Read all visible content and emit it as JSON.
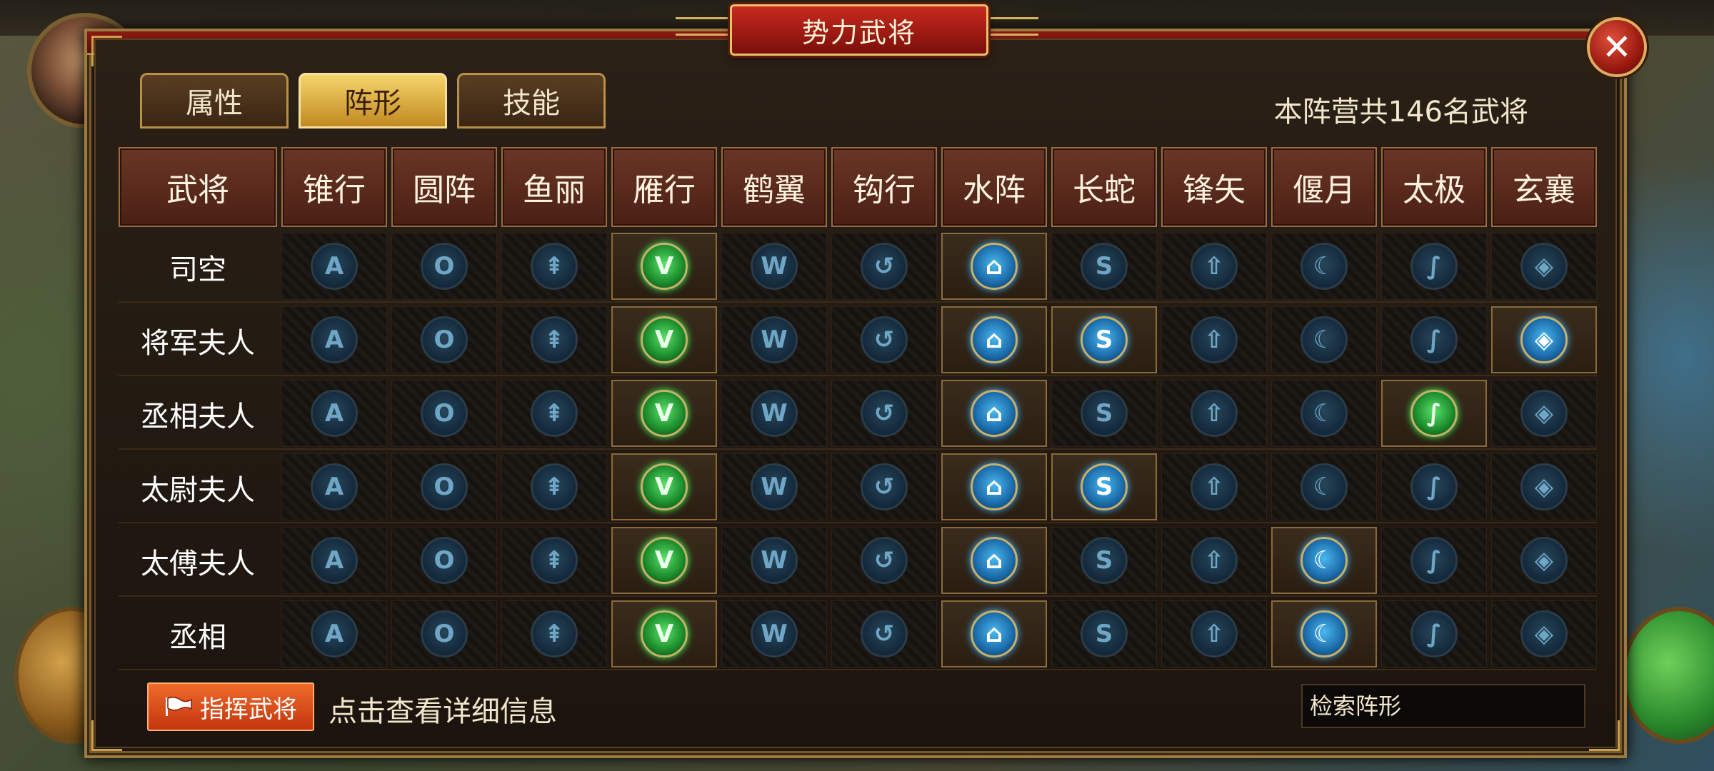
{
  "window": {
    "title": "势力武将",
    "close_label": "✕"
  },
  "tabs": [
    {
      "label": "属性",
      "active": false
    },
    {
      "label": "阵形",
      "active": true
    },
    {
      "label": "技能",
      "active": false
    }
  ],
  "summary": "本阵营共146名武将",
  "table": {
    "name_header": "武将",
    "formations": [
      {
        "label": "锥行",
        "glyph": "A",
        "icon": "arrowhead-rune-icon"
      },
      {
        "label": "圆阵",
        "glyph": "O",
        "icon": "circle-rune-icon"
      },
      {
        "label": "鱼丽",
        "glyph": "⇞",
        "icon": "fish-scale-rune-icon"
      },
      {
        "label": "雁行",
        "glyph": "V",
        "icon": "goose-v-rune-icon"
      },
      {
        "label": "鹤翼",
        "glyph": "W",
        "icon": "crane-wing-rune-icon"
      },
      {
        "label": "钩行",
        "glyph": "↺",
        "icon": "hook-rune-icon"
      },
      {
        "label": "水阵",
        "glyph": "⌂",
        "icon": "water-rune-icon"
      },
      {
        "label": "长蛇",
        "glyph": "S",
        "icon": "snake-rune-icon"
      },
      {
        "label": "锋矢",
        "glyph": "⇧",
        "icon": "arrow-rune-icon"
      },
      {
        "label": "偃月",
        "glyph": "☾",
        "icon": "crescent-rune-icon"
      },
      {
        "label": "太极",
        "glyph": "∫",
        "icon": "taiji-rune-icon"
      },
      {
        "label": "玄襄",
        "glyph": "◈",
        "icon": "diamond-rune-icon"
      }
    ],
    "rows": [
      {
        "name": "司空",
        "states": [
          "dim",
          "dim",
          "dim",
          "green",
          "dim",
          "dim",
          "blue",
          "dim",
          "dim",
          "dim",
          "dim",
          "dim"
        ]
      },
      {
        "name": "将军夫人",
        "states": [
          "dim",
          "dim",
          "dim",
          "green",
          "dim",
          "dim",
          "blue",
          "blue",
          "dim",
          "dim",
          "dim",
          "blue"
        ]
      },
      {
        "name": "丞相夫人",
        "states": [
          "dim",
          "dim",
          "dim",
          "green",
          "dim",
          "dim",
          "blue",
          "dim",
          "dim",
          "dim",
          "green",
          "dim"
        ]
      },
      {
        "name": "太尉夫人",
        "states": [
          "dim",
          "dim",
          "dim",
          "green",
          "dim",
          "dim",
          "blue",
          "blue",
          "dim",
          "dim",
          "dim",
          "dim"
        ]
      },
      {
        "name": "太傅夫人",
        "states": [
          "dim",
          "dim",
          "dim",
          "green",
          "dim",
          "dim",
          "blue",
          "dim",
          "dim",
          "blue",
          "dim",
          "dim"
        ]
      },
      {
        "name": "丞相",
        "states": [
          "dim",
          "dim",
          "dim",
          "green",
          "dim",
          "dim",
          "blue",
          "dim",
          "dim",
          "blue",
          "dim",
          "dim"
        ]
      }
    ]
  },
  "footer": {
    "command_button": "指挥武将",
    "hint": "点击查看详细信息",
    "search_placeholder": "检索阵形"
  },
  "colors": {
    "active_blue": "#4ab8f0",
    "active_green": "#5ae06a",
    "title_red": "#c92a1e",
    "gold_border": "#d8b060"
  }
}
